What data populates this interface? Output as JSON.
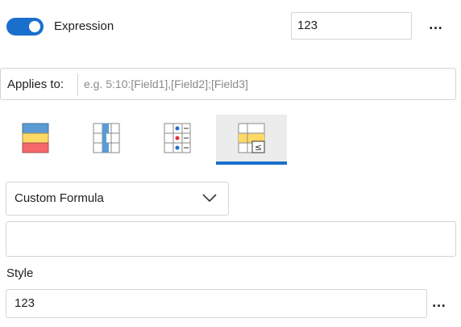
{
  "expression": {
    "toggle_on": true,
    "label": "Expression",
    "value": "123",
    "more_label": "…"
  },
  "applies_to": {
    "label": "Applies to:",
    "placeholder": "e.g. 5:10:[Field1],[Field2];[Field3]"
  },
  "rule_tabs": [
    {
      "name": "color-scale",
      "active": false
    },
    {
      "name": "data-bar",
      "active": false
    },
    {
      "name": "icon-set",
      "active": false
    },
    {
      "name": "custom-rule",
      "active": true,
      "icon_text": "≤"
    }
  ],
  "formula": {
    "selected": "Custom Formula",
    "value": ""
  },
  "style": {
    "label": "Style",
    "value": "123",
    "more_label": "…"
  },
  "colors": {
    "accent": "#1a6fcc",
    "scale_top": "#5b9bd5",
    "scale_mid": "#ffd966",
    "scale_bottom": "#f4676b",
    "border": "#d4d4d4"
  }
}
